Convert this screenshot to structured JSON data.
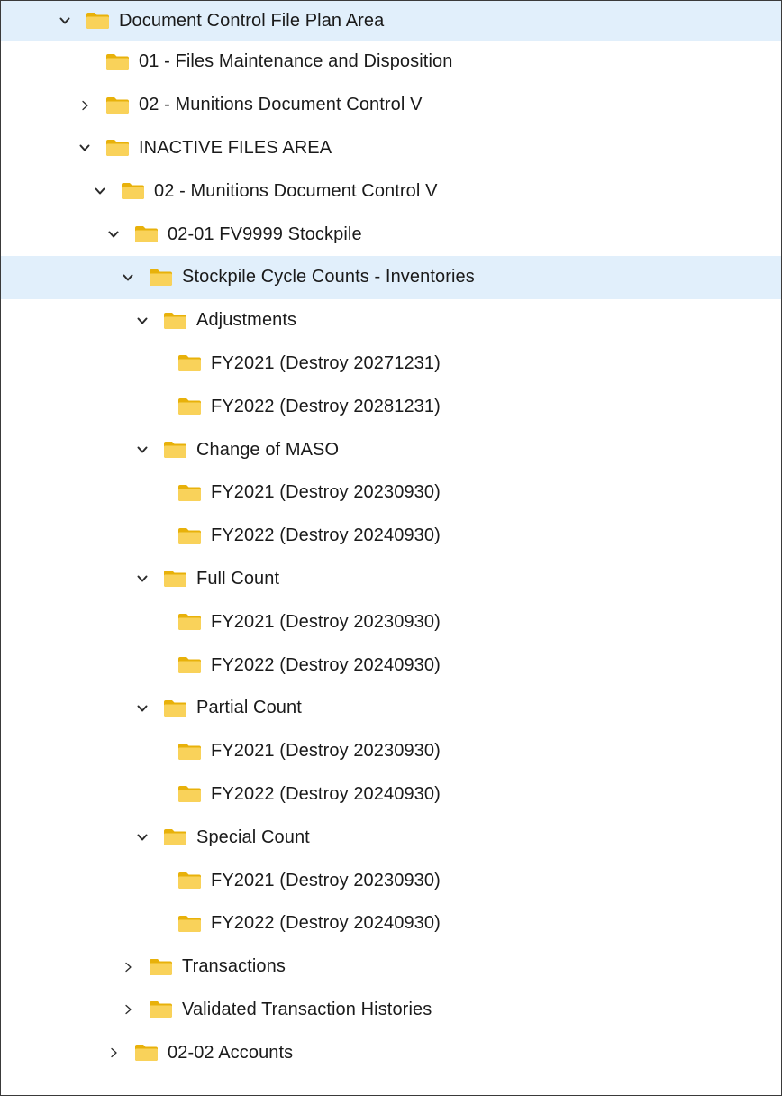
{
  "tree": [
    {
      "label": "Document Control File Plan Area",
      "level": 0,
      "state": "expanded",
      "selected": true,
      "indent": 64
    },
    {
      "label": "01 - Files Maintenance and Disposition",
      "level": 1,
      "state": "none",
      "selected": false,
      "indent": 86
    },
    {
      "label": "02 - Munitions Document Control V",
      "level": 1,
      "state": "collapsed",
      "selected": false,
      "indent": 86
    },
    {
      "label": "INACTIVE FILES AREA",
      "level": 1,
      "state": "expanded",
      "selected": false,
      "indent": 86
    },
    {
      "label": "02 - Munitions Document Control V",
      "level": 2,
      "state": "expanded",
      "selected": false,
      "indent": 103
    },
    {
      "label": "02-01 FV9999 Stockpile",
      "level": 3,
      "state": "expanded",
      "selected": false,
      "indent": 118
    },
    {
      "label": "Stockpile Cycle Counts - Inventories",
      "level": 4,
      "state": "expanded",
      "selected": true,
      "indent": 134
    },
    {
      "label": "Adjustments",
      "level": 5,
      "state": "expanded",
      "selected": false,
      "indent": 150
    },
    {
      "label": "FY2021 (Destroy 20271231)",
      "level": 6,
      "state": "none",
      "selected": false,
      "indent": 166
    },
    {
      "label": "FY2022 (Destroy 20281231)",
      "level": 6,
      "state": "none",
      "selected": false,
      "indent": 166
    },
    {
      "label": "Change of MASO",
      "level": 5,
      "state": "expanded",
      "selected": false,
      "indent": 150
    },
    {
      "label": "FY2021 (Destroy 20230930)",
      "level": 6,
      "state": "none",
      "selected": false,
      "indent": 166
    },
    {
      "label": "FY2022 (Destroy 20240930)",
      "level": 6,
      "state": "none",
      "selected": false,
      "indent": 166
    },
    {
      "label": "Full Count",
      "level": 5,
      "state": "expanded",
      "selected": false,
      "indent": 150
    },
    {
      "label": "FY2021 (Destroy 20230930)",
      "level": 6,
      "state": "none",
      "selected": false,
      "indent": 166
    },
    {
      "label": "FY2022 (Destroy 20240930)",
      "level": 6,
      "state": "none",
      "selected": false,
      "indent": 166
    },
    {
      "label": "Partial Count",
      "level": 5,
      "state": "expanded",
      "selected": false,
      "indent": 150
    },
    {
      "label": "FY2021 (Destroy 20230930)",
      "level": 6,
      "state": "none",
      "selected": false,
      "indent": 166
    },
    {
      "label": "FY2022 (Destroy 20240930)",
      "level": 6,
      "state": "none",
      "selected": false,
      "indent": 166
    },
    {
      "label": "Special Count",
      "level": 5,
      "state": "expanded",
      "selected": false,
      "indent": 150
    },
    {
      "label": "FY2021 (Destroy 20230930)",
      "level": 6,
      "state": "none",
      "selected": false,
      "indent": 166
    },
    {
      "label": "FY2022 (Destroy 20240930)",
      "level": 6,
      "state": "none",
      "selected": false,
      "indent": 166
    },
    {
      "label": "Transactions",
      "level": 4,
      "state": "collapsed",
      "selected": false,
      "indent": 134
    },
    {
      "label": "Validated Transaction Histories",
      "level": 4,
      "state": "collapsed",
      "selected": false,
      "indent": 134
    },
    {
      "label": "02-02 Accounts",
      "level": 3,
      "state": "collapsed",
      "selected": false,
      "indent": 118
    }
  ],
  "colors": {
    "selection": "#e1effb",
    "folder_back": "#e8b10a",
    "folder_front": "#f9d25a",
    "chevron": "#2b2b2b"
  },
  "icons": {
    "folder": "folder-icon",
    "expanded": "chevron-down-icon",
    "collapsed": "chevron-right-icon"
  }
}
